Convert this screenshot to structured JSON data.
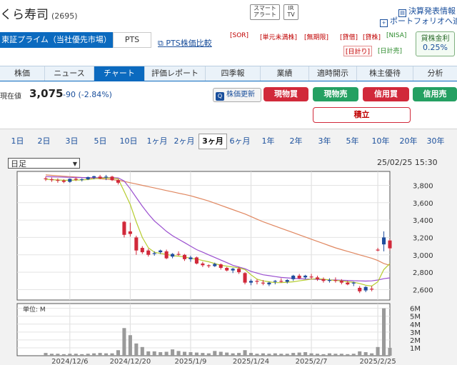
{
  "title": {
    "name": "くら寿司",
    "code": "(2695)"
  },
  "top_buttons": [
    {
      "line1": "スマート",
      "line2": "アラート"
    },
    {
      "line1": "IR",
      "line2": "TV"
    }
  ],
  "top_links": [
    "決算発表情報",
    "ポートフォリオへ追加"
  ],
  "market_tabs": [
    {
      "label": "東証プライム（当社優先市場）",
      "active": true
    },
    {
      "label": "PTS",
      "active": false
    }
  ],
  "pts_link": "PTS株価比較",
  "tags_row1": [
    "[SOR]",
    "[単元未満株]",
    "[無期限]",
    "[貸借]",
    "[貸株]",
    "[NISA]"
  ],
  "tags_row2": [
    "[日計り]",
    "[日計売]"
  ],
  "lending": {
    "label": "貸株金利",
    "value": "0.25%"
  },
  "nav_tabs": [
    {
      "label": "株価",
      "active": false
    },
    {
      "label": "ニュース",
      "active": false
    },
    {
      "label": "チャート",
      "active": true
    },
    {
      "label": "評価レポート",
      "active": false
    },
    {
      "label": "四季報",
      "active": false
    },
    {
      "label": "業績",
      "active": false
    },
    {
      "label": "適時開示",
      "active": false
    },
    {
      "label": "株主優待",
      "active": false
    },
    {
      "label": "分析",
      "active": false
    }
  ],
  "price": {
    "label": "現在値",
    "value": "3,075",
    "change": "-90 (-2.84%)"
  },
  "refresh_label": "株価更新",
  "trade_buttons": [
    {
      "label": "現物買",
      "color": "#d1293a"
    },
    {
      "label": "現物売",
      "color": "#24a062"
    },
    {
      "label": "信用買",
      "color": "#d1293a"
    },
    {
      "label": "信用売",
      "color": "#24a062"
    }
  ],
  "tsumitate_label": "積立",
  "ranges": [
    {
      "label": "1日",
      "active": false
    },
    {
      "label": "2日",
      "active": false
    },
    {
      "label": "3日",
      "active": false
    },
    {
      "label": "5日",
      "active": false
    },
    {
      "label": "10日",
      "active": false
    },
    {
      "label": "1ヶ月",
      "active": false
    },
    {
      "label": "2ヶ月",
      "active": false
    },
    {
      "label": "3ヶ月",
      "active": true
    },
    {
      "label": "6ヶ月",
      "active": false
    },
    {
      "label": "1年",
      "active": false
    },
    {
      "label": "2年",
      "active": false
    },
    {
      "label": "3年",
      "active": false
    },
    {
      "label": "5年",
      "active": false
    },
    {
      "label": "10年",
      "active": false
    },
    {
      "label": "20年",
      "active": false
    },
    {
      "label": "30年",
      "active": false
    }
  ],
  "period_select": "日足",
  "datetime": "25/02/25 15:30",
  "chart_data": {
    "type": "candlestick",
    "price_axis": {
      "ticks": [
        "3,800",
        "3,600",
        "3,400",
        "3,200",
        "3,000",
        "2,800",
        "2,600"
      ],
      "ylim": [
        2480,
        3960
      ]
    },
    "volume_axis": {
      "unit_label": "単位: M",
      "ticks": [
        "6M",
        "5M",
        "4M",
        "3M",
        "2M",
        "1M"
      ],
      "ylim": [
        0,
        6.6
      ]
    },
    "x_ticks": [
      {
        "label": "2024/12/6",
        "i": 4
      },
      {
        "label": "2024/12/20",
        "i": 14
      },
      {
        "label": "2025/1/9",
        "i": 24
      },
      {
        "label": "2025/1/24",
        "i": 34
      },
      {
        "label": "2025/2/7",
        "i": 44
      },
      {
        "label": "2025/2/25",
        "i": 55
      }
    ],
    "candles": [
      [
        3880,
        3900,
        3850,
        3870
      ],
      [
        3870,
        3890,
        3840,
        3860
      ],
      [
        3860,
        3880,
        3830,
        3855
      ],
      [
        3855,
        3870,
        3825,
        3840
      ],
      [
        3840,
        3880,
        3830,
        3875
      ],
      [
        3875,
        3890,
        3850,
        3865
      ],
      [
        3865,
        3880,
        3845,
        3870
      ],
      [
        3870,
        3900,
        3860,
        3895
      ],
      [
        3890,
        3910,
        3870,
        3905
      ],
      [
        3900,
        3920,
        3870,
        3880
      ],
      [
        3890,
        3920,
        3860,
        3900
      ],
      [
        3900,
        3910,
        3850,
        3860
      ],
      [
        3860,
        3870,
        3810,
        3830
      ],
      [
        3380,
        3390,
        3200,
        3230
      ],
      [
        3270,
        3370,
        3210,
        3240
      ],
      [
        3200,
        3220,
        3000,
        3050
      ],
      [
        3080,
        3100,
        3010,
        3030
      ],
      [
        3050,
        3070,
        2980,
        3000
      ],
      [
        3010,
        3040,
        2990,
        3020
      ],
      [
        3030,
        3060,
        3010,
        3050
      ],
      [
        3040,
        3060,
        2950,
        2960
      ],
      [
        2980,
        3020,
        2960,
        3010
      ],
      [
        3010,
        3040,
        2990,
        3000
      ],
      [
        3000,
        3010,
        2930,
        2950
      ],
      [
        2950,
        2990,
        2920,
        2970
      ],
      [
        2970,
        2980,
        2890,
        2900
      ],
      [
        2900,
        2920,
        2860,
        2880
      ],
      [
        2880,
        2890,
        2850,
        2870
      ],
      [
        2870,
        2910,
        2860,
        2895
      ],
      [
        2890,
        2900,
        2830,
        2850
      ],
      [
        2850,
        2860,
        2810,
        2820
      ],
      [
        2820,
        2850,
        2790,
        2840
      ],
      [
        2840,
        2860,
        2780,
        2800
      ],
      [
        2790,
        2800,
        2660,
        2680
      ],
      [
        2680,
        2720,
        2650,
        2700
      ],
      [
        2700,
        2720,
        2660,
        2690
      ],
      [
        2680,
        2710,
        2650,
        2670
      ],
      [
        2660,
        2690,
        2640,
        2680
      ],
      [
        2690,
        2710,
        2660,
        2700
      ],
      [
        2700,
        2730,
        2680,
        2690
      ],
      [
        2690,
        2720,
        2670,
        2710
      ],
      [
        2720,
        2770,
        2700,
        2760
      ],
      [
        2760,
        2780,
        2720,
        2730
      ],
      [
        2740,
        2770,
        2720,
        2760
      ],
      [
        2750,
        2780,
        2720,
        2740
      ],
      [
        2740,
        2760,
        2700,
        2720
      ],
      [
        2720,
        2740,
        2680,
        2700
      ],
      [
        2700,
        2730,
        2680,
        2710
      ],
      [
        2710,
        2740,
        2680,
        2700
      ],
      [
        2700,
        2720,
        2660,
        2680
      ],
      [
        2680,
        2700,
        2650,
        2660
      ],
      [
        2670,
        2690,
        2640,
        2680
      ],
      [
        2620,
        2640,
        2560,
        2580
      ],
      [
        2590,
        2640,
        2570,
        2630
      ],
      [
        2610,
        2640,
        2580,
        2600
      ],
      [
        3060,
        3080,
        3040,
        3050
      ],
      [
        3120,
        3270,
        3040,
        3200
      ],
      [
        3165,
        3180,
        3050,
        3075
      ]
    ],
    "ma_short": [
      3870,
      3865,
      3862,
      3858,
      3858,
      3860,
      3862,
      3866,
      3875,
      3880,
      3885,
      3882,
      3875,
      3730,
      3580,
      3380,
      3200,
      3080,
      3030,
      3015,
      3005,
      2990,
      2985,
      2975,
      2960,
      2950,
      2935,
      2920,
      2900,
      2880,
      2870,
      2860,
      2850,
      2830,
      2770,
      2720,
      2700,
      2690,
      2680,
      2680,
      2685,
      2690,
      2700,
      2710,
      2720,
      2725,
      2720,
      2710,
      2705,
      2700,
      2690,
      2685,
      2670,
      2650,
      2640,
      2690,
      2830,
      2900
    ],
    "ma_mid": [
      3900,
      3898,
      3896,
      3894,
      3892,
      3890,
      3889,
      3888,
      3888,
      3888,
      3889,
      3888,
      3885,
      3850,
      3760,
      3660,
      3560,
      3470,
      3390,
      3330,
      3270,
      3220,
      3180,
      3140,
      3100,
      3060,
      3030,
      3000,
      2970,
      2940,
      2910,
      2880,
      2860,
      2840,
      2810,
      2790,
      2770,
      2760,
      2750,
      2740,
      2735,
      2730,
      2725,
      2722,
      2720,
      2718,
      2715,
      2712,
      2710,
      2708,
      2705,
      2702,
      2700,
      2698,
      2700,
      2710,
      2725,
      2735
    ],
    "ma_long": [
      3920,
      3915,
      3910,
      3905,
      3900,
      3895,
      3890,
      3885,
      3880,
      3875,
      3870,
      3865,
      3858,
      3845,
      3830,
      3815,
      3800,
      3785,
      3770,
      3755,
      3740,
      3725,
      3710,
      3695,
      3680,
      3660,
      3640,
      3620,
      3595,
      3570,
      3545,
      3520,
      3495,
      3470,
      3440,
      3410,
      3380,
      3355,
      3330,
      3305,
      3280,
      3255,
      3230,
      3205,
      3180,
      3155,
      3130,
      3105,
      3080,
      3060,
      3040,
      3020,
      3000,
      2980,
      2960,
      2935,
      2900,
      2880
    ],
    "volume": [
      0.35,
      0.25,
      0.25,
      0.2,
      0.25,
      0.25,
      0.2,
      0.25,
      0.3,
      0.35,
      0.3,
      0.3,
      0.7,
      3.5,
      2.6,
      1.55,
      1.1,
      0.55,
      0.55,
      0.45,
      0.5,
      0.8,
      0.6,
      0.5,
      0.45,
      0.4,
      0.35,
      0.3,
      0.6,
      0.5,
      0.4,
      0.3,
      0.35,
      0.7,
      0.35,
      0.25,
      0.3,
      0.25,
      0.3,
      0.25,
      0.25,
      0.35,
      0.4,
      0.45,
      0.3,
      0.25,
      0.2,
      0.3,
      0.25,
      0.25,
      0.2,
      0.25,
      0.55,
      0.45,
      0.3,
      1.1,
      6.0,
      1.0
    ],
    "colors": {
      "up": "#1f4d9e",
      "down": "#d1293a",
      "ma_short": "#b5cc2e",
      "ma_mid": "#9a4fcf",
      "ma_long": "#e08760",
      "volume": "#9a9a9a"
    }
  }
}
